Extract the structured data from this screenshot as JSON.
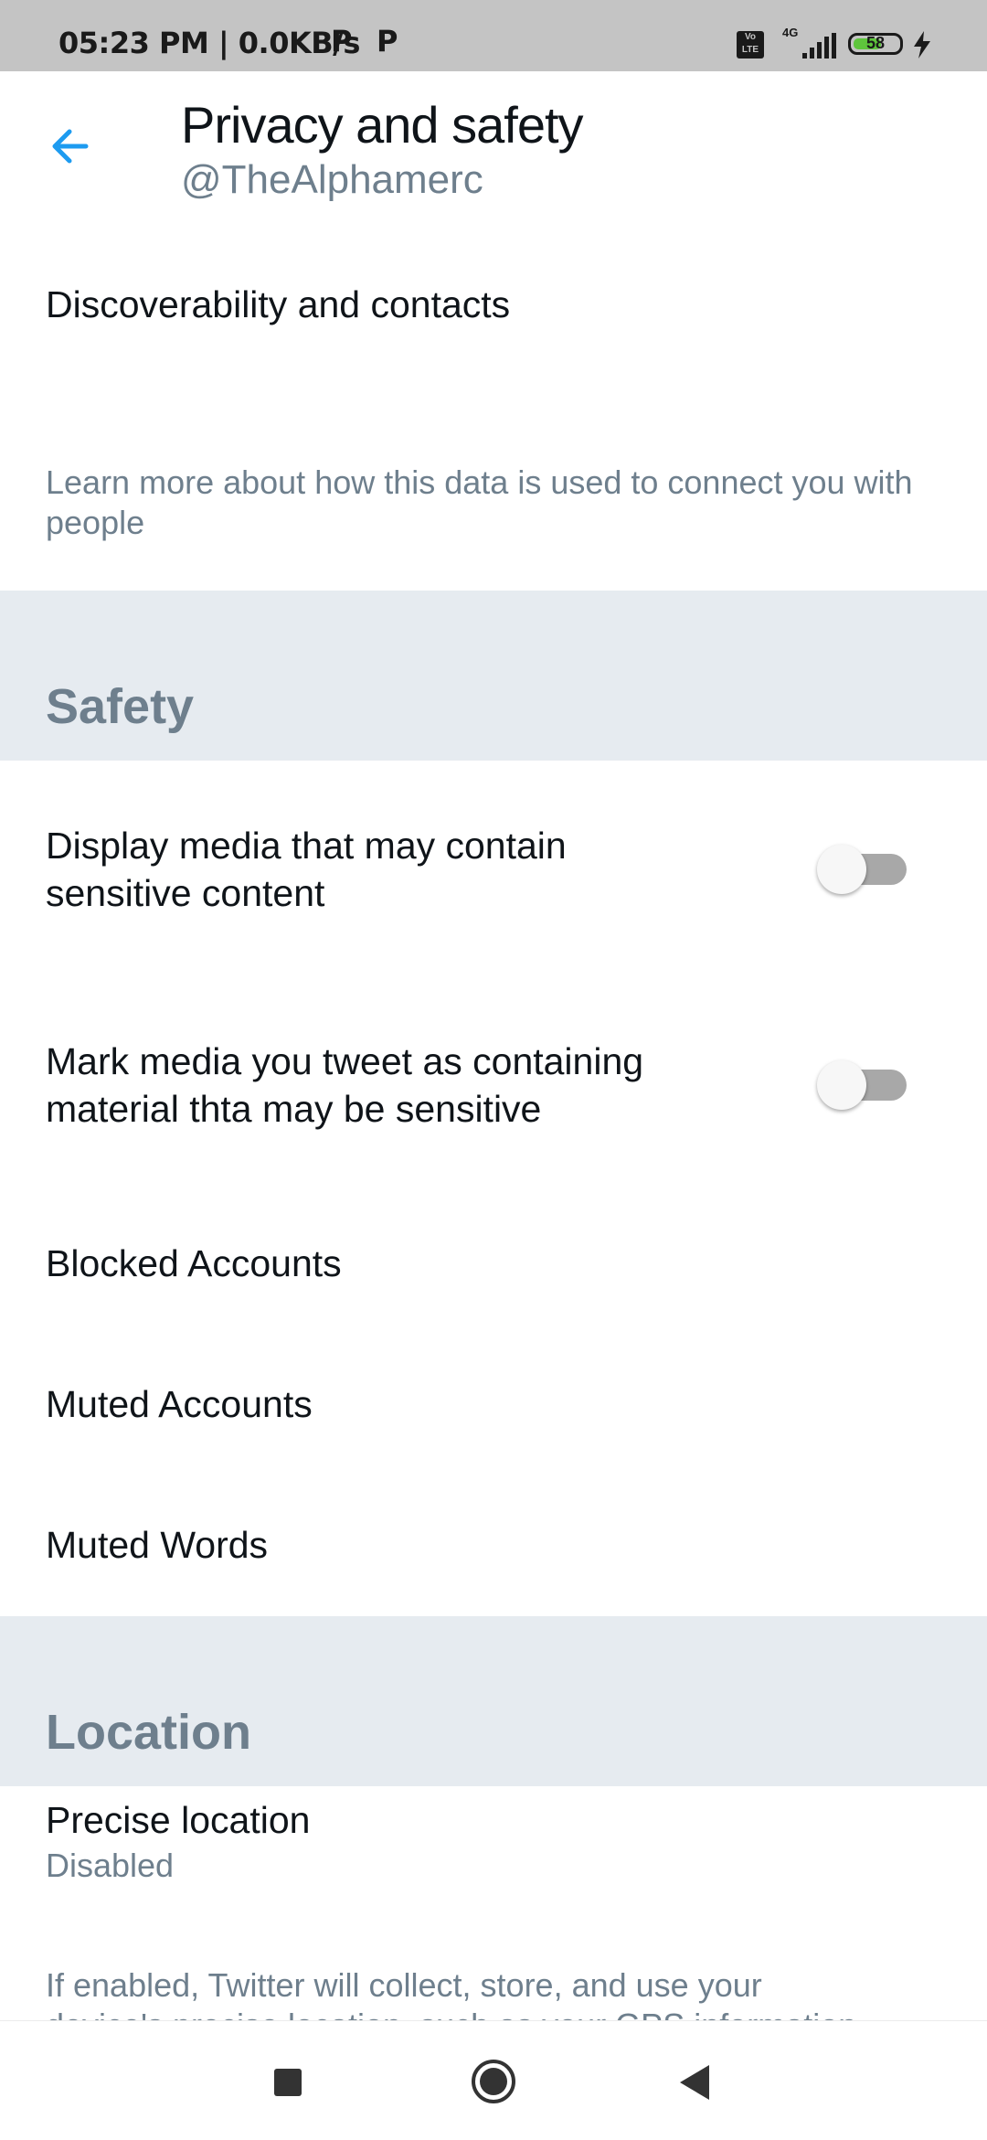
{
  "status_bar": {
    "time_speed": "05:23 PM | 0.0KB/s",
    "network": "4G",
    "volte": "Vo LTE",
    "battery": "58"
  },
  "header": {
    "title": "Privacy and safety",
    "handle": "@TheAlphamerc"
  },
  "items": {
    "discoverability": "Discoverability and contacts",
    "learn_more": "Learn more about how this data is used to connect you with people"
  },
  "safety": {
    "heading": "Safety",
    "display_media_line1": "Display media that may contain",
    "display_media_line2": "sensitive content",
    "display_media_on": false,
    "mark_media_line1": "Mark media you tweet as containing",
    "mark_media_line2": "material thta may be sensitive",
    "mark_media_on": false,
    "blocked": "Blocked Accounts",
    "muted": "Muted Accounts",
    "muted_words": "Muted Words"
  },
  "location": {
    "heading": "Location",
    "precise_title": "Precise location",
    "precise_value": "Disabled",
    "info_line1": "If enabled, Twitter will collect, store, and use your",
    "info_line2": "device's precise location, such as your GPS information"
  },
  "icons": {
    "back": "arrow-left-icon",
    "accent": "#1d9bf0"
  }
}
